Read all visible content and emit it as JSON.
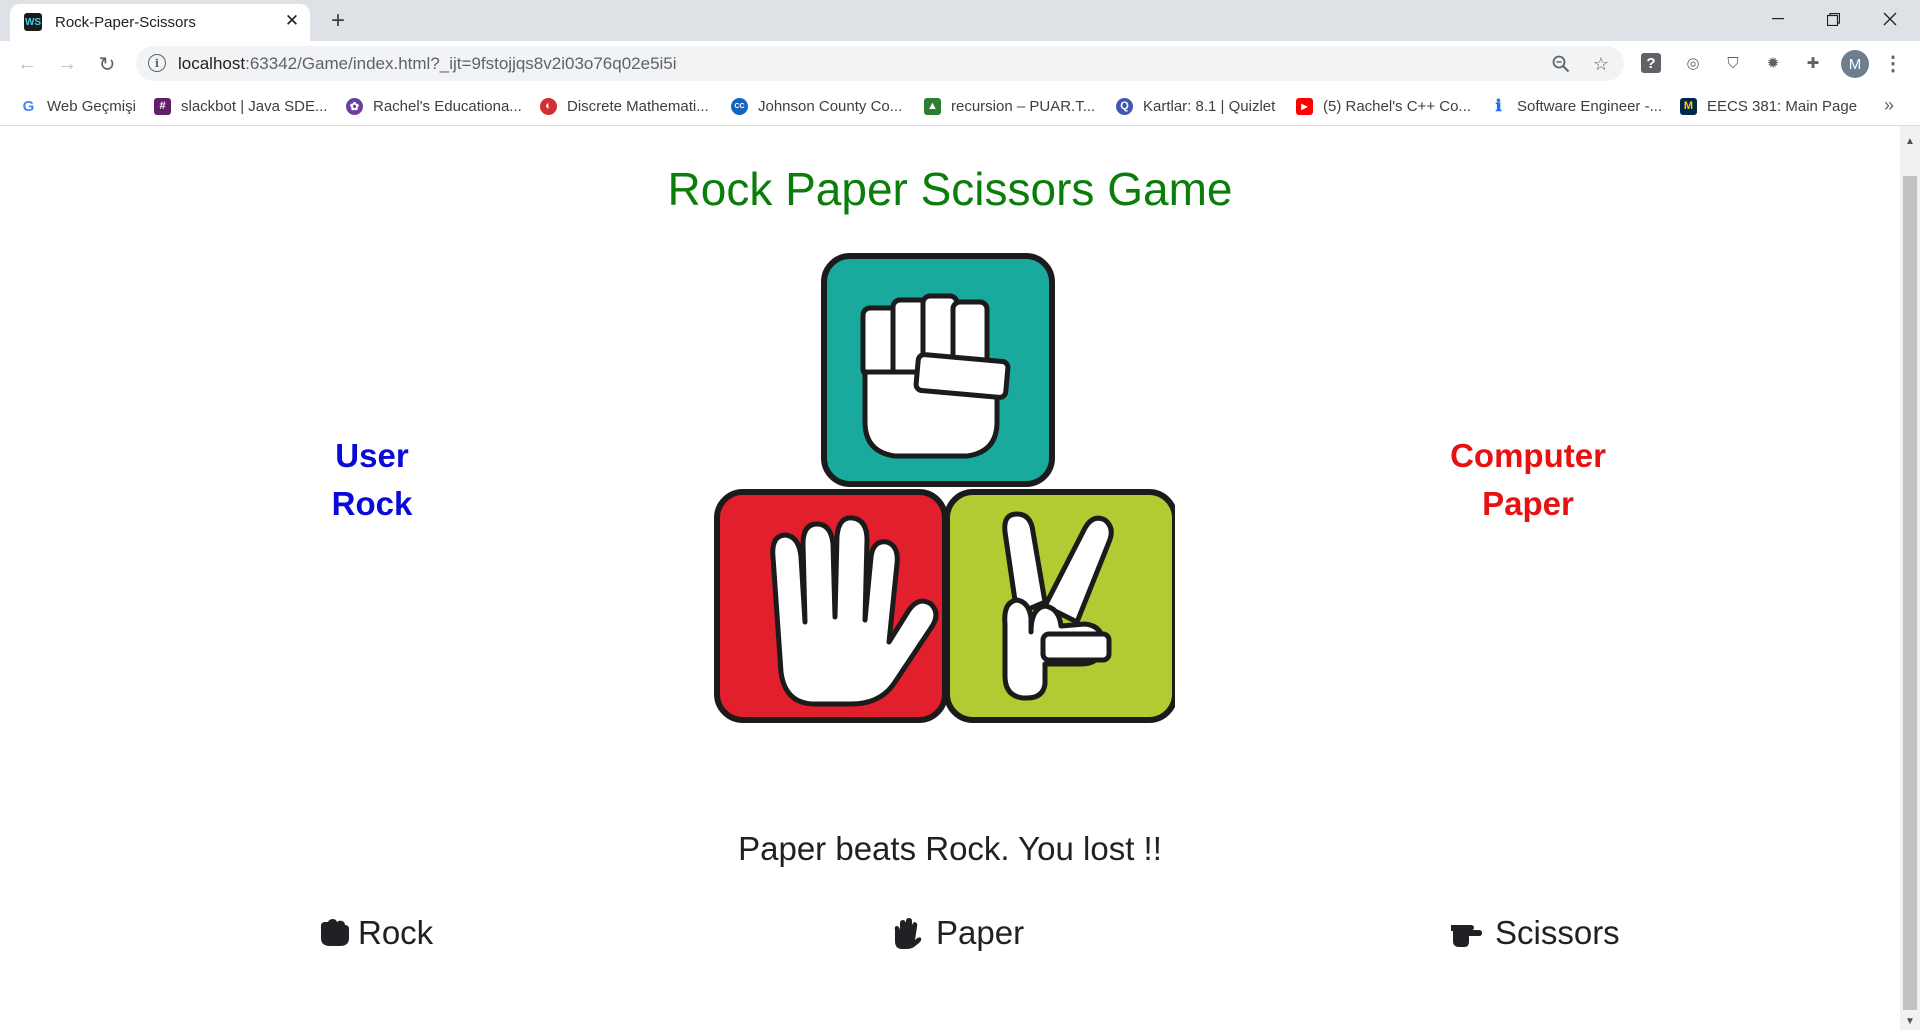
{
  "browser": {
    "tab": {
      "title": "Rock-Paper-Scissors",
      "favicon": "webstorm-icon"
    },
    "url": {
      "host": "localhost",
      "rest": ":63342/Game/index.html?_ijt=9fstojjqs8v2i03o76q02e5i5i"
    },
    "profile_initial": "M",
    "bookmarks": [
      {
        "label": "Web Geçmişi",
        "icon": "google-icon",
        "color": "#4285f4"
      },
      {
        "label": "slackbot | Java SDE...",
        "icon": "slack-icon",
        "color": "#611f69"
      },
      {
        "label": "Rachel's Educationa...",
        "icon": "puzzle-icon",
        "color": "#6b3fa0"
      },
      {
        "label": "Discrete Mathemati...",
        "icon": "book-icon",
        "color": "#d32f2f"
      },
      {
        "label": "Johnson County Co...",
        "icon": "college-icon",
        "color": "#1565c0"
      },
      {
        "label": "recursion – PUAR.T...",
        "icon": "puar-icon",
        "color": "#2e7d32"
      },
      {
        "label": "Kartlar: 8.1 | Quizlet",
        "icon": "quizlet-icon",
        "color": "#4257b2"
      },
      {
        "label": "(5) Rachel's C++ Co...",
        "icon": "youtube-icon",
        "color": "#ff0000"
      },
      {
        "label": "Software Engineer -...",
        "icon": "info-icon",
        "color": "#1a73e8"
      },
      {
        "label": "EECS 381: Main Page",
        "icon": "michigan-icon",
        "color": "#00274c"
      }
    ],
    "bookmarks_more": "»"
  },
  "game": {
    "title": "Rock Paper Scissors Game",
    "user_label": "User",
    "user_choice": "Rock",
    "computer_label": "Computer",
    "computer_choice": "Paper",
    "result": "Paper beats Rock. You lost !!",
    "buttons": {
      "rock": "Rock",
      "paper": "Paper",
      "scissors": "Scissors"
    }
  },
  "colors": {
    "title": "#0a7d0a",
    "user": "#0a0ad6",
    "computer": "#e81111",
    "rock_tile": "#1aa99d",
    "paper_tile": "#e11f2d",
    "scissors_tile": "#b1cb33"
  }
}
